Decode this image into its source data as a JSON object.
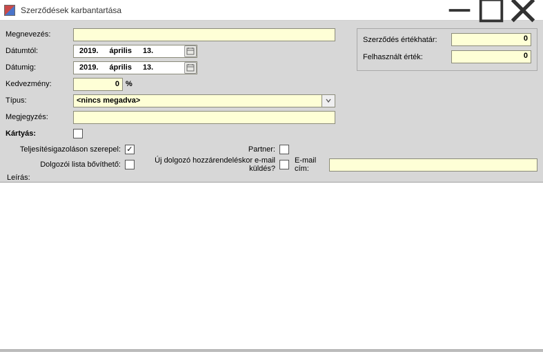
{
  "window": {
    "title": "Szerződések karbantartása"
  },
  "labels": {
    "megnevezes": "Megnevezés:",
    "datumtol": "Dátumtól:",
    "datumig": "Dátumig:",
    "kedvezmeny": "Kedvezmény:",
    "tipus": "Típus:",
    "megjegyzes": "Megjegyzés:",
    "kartyas": "Kártyás:",
    "teljesites": "Teljesítésigazoláson szerepel:",
    "dolgozoi": "Dolgozói lista bővíthető:",
    "ujdolgozo": "Új dolgozó hozzárendeléskor e-mail küldés?",
    "partner": "Partner:",
    "emailcim": "E-mail cím:",
    "leiras": "Leírás:",
    "pct": "%"
  },
  "values": {
    "megnevezes": "",
    "datumtol": {
      "year": "2019.",
      "month": "április",
      "day": "13."
    },
    "datumig": {
      "year": "2019.",
      "month": "április",
      "day": "13."
    },
    "kedvezmeny": "0",
    "tipus": "<nincs megadva>",
    "megjegyzes": "",
    "kartyas_checked": false,
    "teljesites_checked": true,
    "dolgozoi_checked": false,
    "ujdolgozo_checked": false,
    "partner_checked": false,
    "emailcim": "",
    "leiras": ""
  },
  "side": {
    "ertekhatar_label": "Szerződés értékhatár:",
    "ertekhatar_value": "0",
    "felhasznalt_label": "Felhasznált érték:",
    "felhasznalt_value": "0"
  },
  "icons": {
    "calendar": "calendar-icon",
    "chevron_down": "chevron-down-icon",
    "minimize": "minimize-icon",
    "maximize": "maximize-icon",
    "close": "close-icon"
  }
}
